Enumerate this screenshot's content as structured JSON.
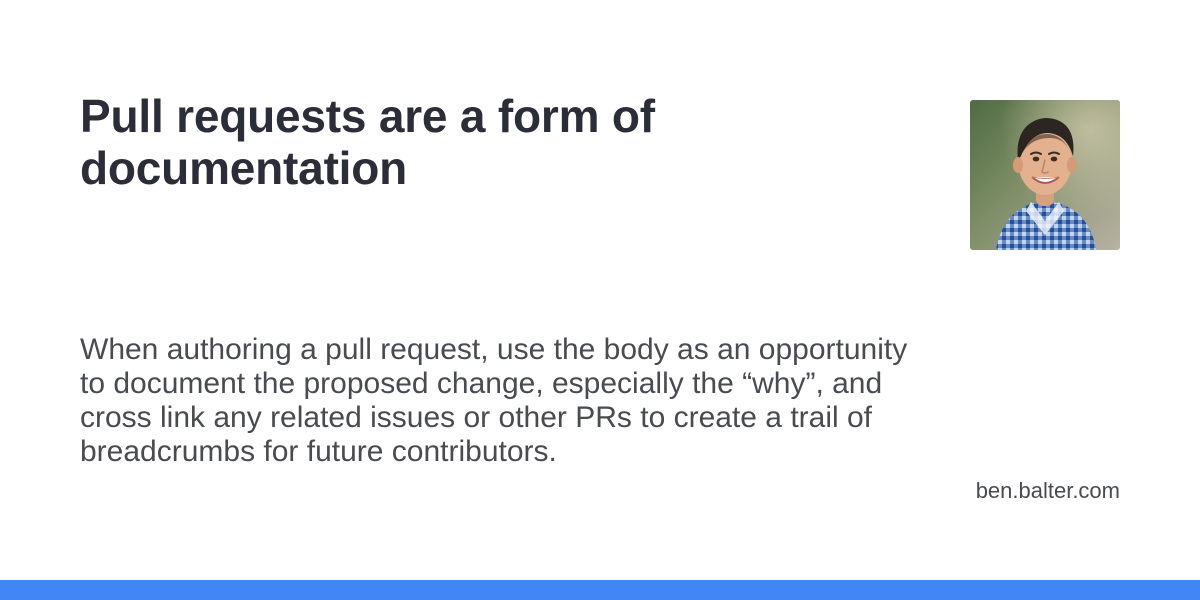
{
  "card": {
    "title": "Pull requests are a form of documentation",
    "description": "When authoring a pull request, use the body as an opportunity to document the proposed change, especially the “why”, and cross link any related issues or other PRs to create a trail of breadcrumbs for future contributors.",
    "site": "ben.balter.com",
    "avatar_icon": "author-avatar-photo"
  },
  "colors": {
    "background": "#ffffff",
    "title": "#2b2d38",
    "text": "#4a4b50",
    "accent_bar": "#4285f4"
  }
}
